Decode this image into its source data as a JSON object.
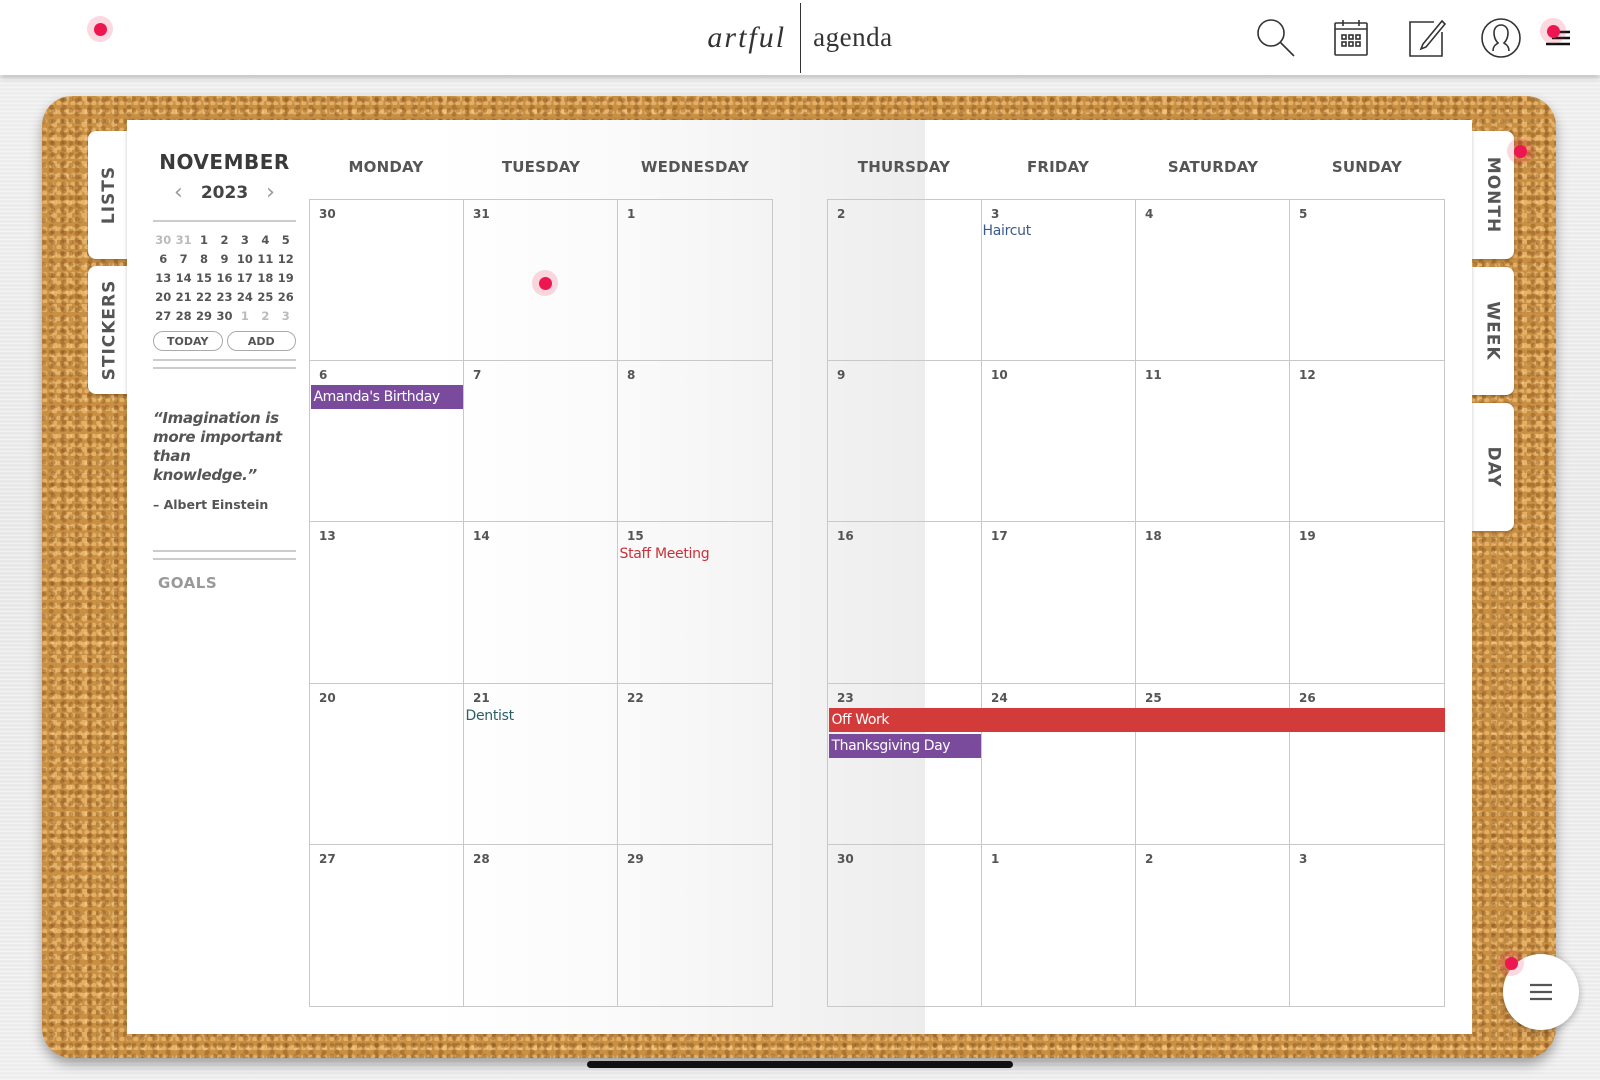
{
  "app": {
    "brand_left": "artful",
    "brand_right": "agenda"
  },
  "toolbar": {
    "icons": [
      "search-icon",
      "calendar-icon",
      "edit-note-icon",
      "profile-icon",
      "menu-icon"
    ]
  },
  "side_tabs": {
    "left": [
      {
        "label": "LISTS"
      },
      {
        "label": "STICKERS"
      }
    ],
    "right": [
      {
        "label": "MONTH",
        "active": true
      },
      {
        "label": "WEEK"
      },
      {
        "label": "DAY"
      }
    ]
  },
  "sidebar": {
    "month": "NOVEMBER",
    "year": "2023",
    "prev_icon": "‹",
    "next_icon": "›",
    "mini_calendar": [
      {
        "d": "30",
        "muted": true
      },
      {
        "d": "31",
        "muted": true
      },
      {
        "d": "1"
      },
      {
        "d": "2"
      },
      {
        "d": "3"
      },
      {
        "d": "4"
      },
      {
        "d": "5"
      },
      {
        "d": "6"
      },
      {
        "d": "7"
      },
      {
        "d": "8"
      },
      {
        "d": "9"
      },
      {
        "d": "10"
      },
      {
        "d": "11"
      },
      {
        "d": "12"
      },
      {
        "d": "13"
      },
      {
        "d": "14"
      },
      {
        "d": "15"
      },
      {
        "d": "16"
      },
      {
        "d": "17"
      },
      {
        "d": "18"
      },
      {
        "d": "19"
      },
      {
        "d": "20"
      },
      {
        "d": "21"
      },
      {
        "d": "22"
      },
      {
        "d": "23"
      },
      {
        "d": "24"
      },
      {
        "d": "25"
      },
      {
        "d": "26"
      },
      {
        "d": "27"
      },
      {
        "d": "28"
      },
      {
        "d": "29"
      },
      {
        "d": "30"
      },
      {
        "d": "1",
        "muted": true
      },
      {
        "d": "2",
        "muted": true
      },
      {
        "d": "3",
        "muted": true
      }
    ],
    "today_label": "TODAY",
    "add_label": "ADD",
    "quote": "“Imagination is more important than knowledge.”",
    "quote_author": "– Albert Einstein",
    "goals_label": "GOALS"
  },
  "calendar": {
    "left_days": [
      "MONDAY",
      "TUESDAY",
      "WEDNESDAY"
    ],
    "right_days": [
      "THURSDAY",
      "FRIDAY",
      "SATURDAY",
      "SUNDAY"
    ],
    "weeks": [
      [
        "30",
        "31",
        "1",
        "2",
        "3",
        "4",
        "5"
      ],
      [
        "6",
        "7",
        "8",
        "9",
        "10",
        "11",
        "12"
      ],
      [
        "13",
        "14",
        "15",
        "16",
        "17",
        "18",
        "19"
      ],
      [
        "20",
        "21",
        "22",
        "23",
        "24",
        "25",
        "26"
      ],
      [
        "27",
        "28",
        "29",
        "30",
        "1",
        "2",
        "3"
      ]
    ],
    "events": [
      {
        "title": "Haircut",
        "week": 0,
        "day": 4,
        "style": "text",
        "color": "#3b5a8c"
      },
      {
        "title": "Amanda's Birthday",
        "week": 1,
        "day": 0,
        "style": "bar",
        "color": "#7a4b9c",
        "span": 1
      },
      {
        "title": "Staff Meeting",
        "week": 2,
        "day": 2,
        "style": "text",
        "color": "#c9303a"
      },
      {
        "title": "Dentist",
        "week": 3,
        "day": 1,
        "style": "text",
        "color": "#2a5f67"
      },
      {
        "title": "Off Work",
        "week": 3,
        "day": 3,
        "style": "bar",
        "color": "#d33a3a",
        "span": 4,
        "row": 0
      },
      {
        "title": "Thanksgiving Day",
        "week": 3,
        "day": 3,
        "style": "bar",
        "color": "#7a4b9c",
        "span": 1,
        "row": 1
      }
    ]
  },
  "colors": {
    "touch_indicator": "#ee1650",
    "event_purple": "#7a4b9c",
    "event_red": "#d33a3a",
    "cork": "#c98f43"
  },
  "fab": {
    "icon": "menu-icon"
  }
}
